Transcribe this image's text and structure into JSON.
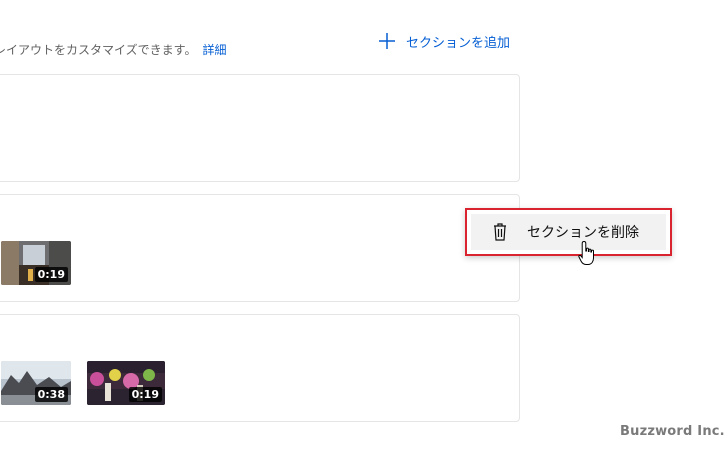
{
  "header": {
    "description": "レイアウトをカスタマイズできます。",
    "details_link": "詳細",
    "add_section_label": "セクションを追加"
  },
  "sections": [
    {
      "videos": []
    },
    {
      "videos": [
        {
          "duration": "0:19"
        }
      ]
    },
    {
      "videos": [
        {
          "duration": "0:38"
        },
        {
          "duration": "0:19"
        }
      ]
    }
  ],
  "context_menu": {
    "delete_section_label": "セクションを削除",
    "icon": "trash-icon"
  },
  "watermark": "Buzzword Inc.",
  "colors": {
    "link": "#065fd4",
    "highlight_border": "#d9232e",
    "card_border": "#e5e5e5"
  }
}
